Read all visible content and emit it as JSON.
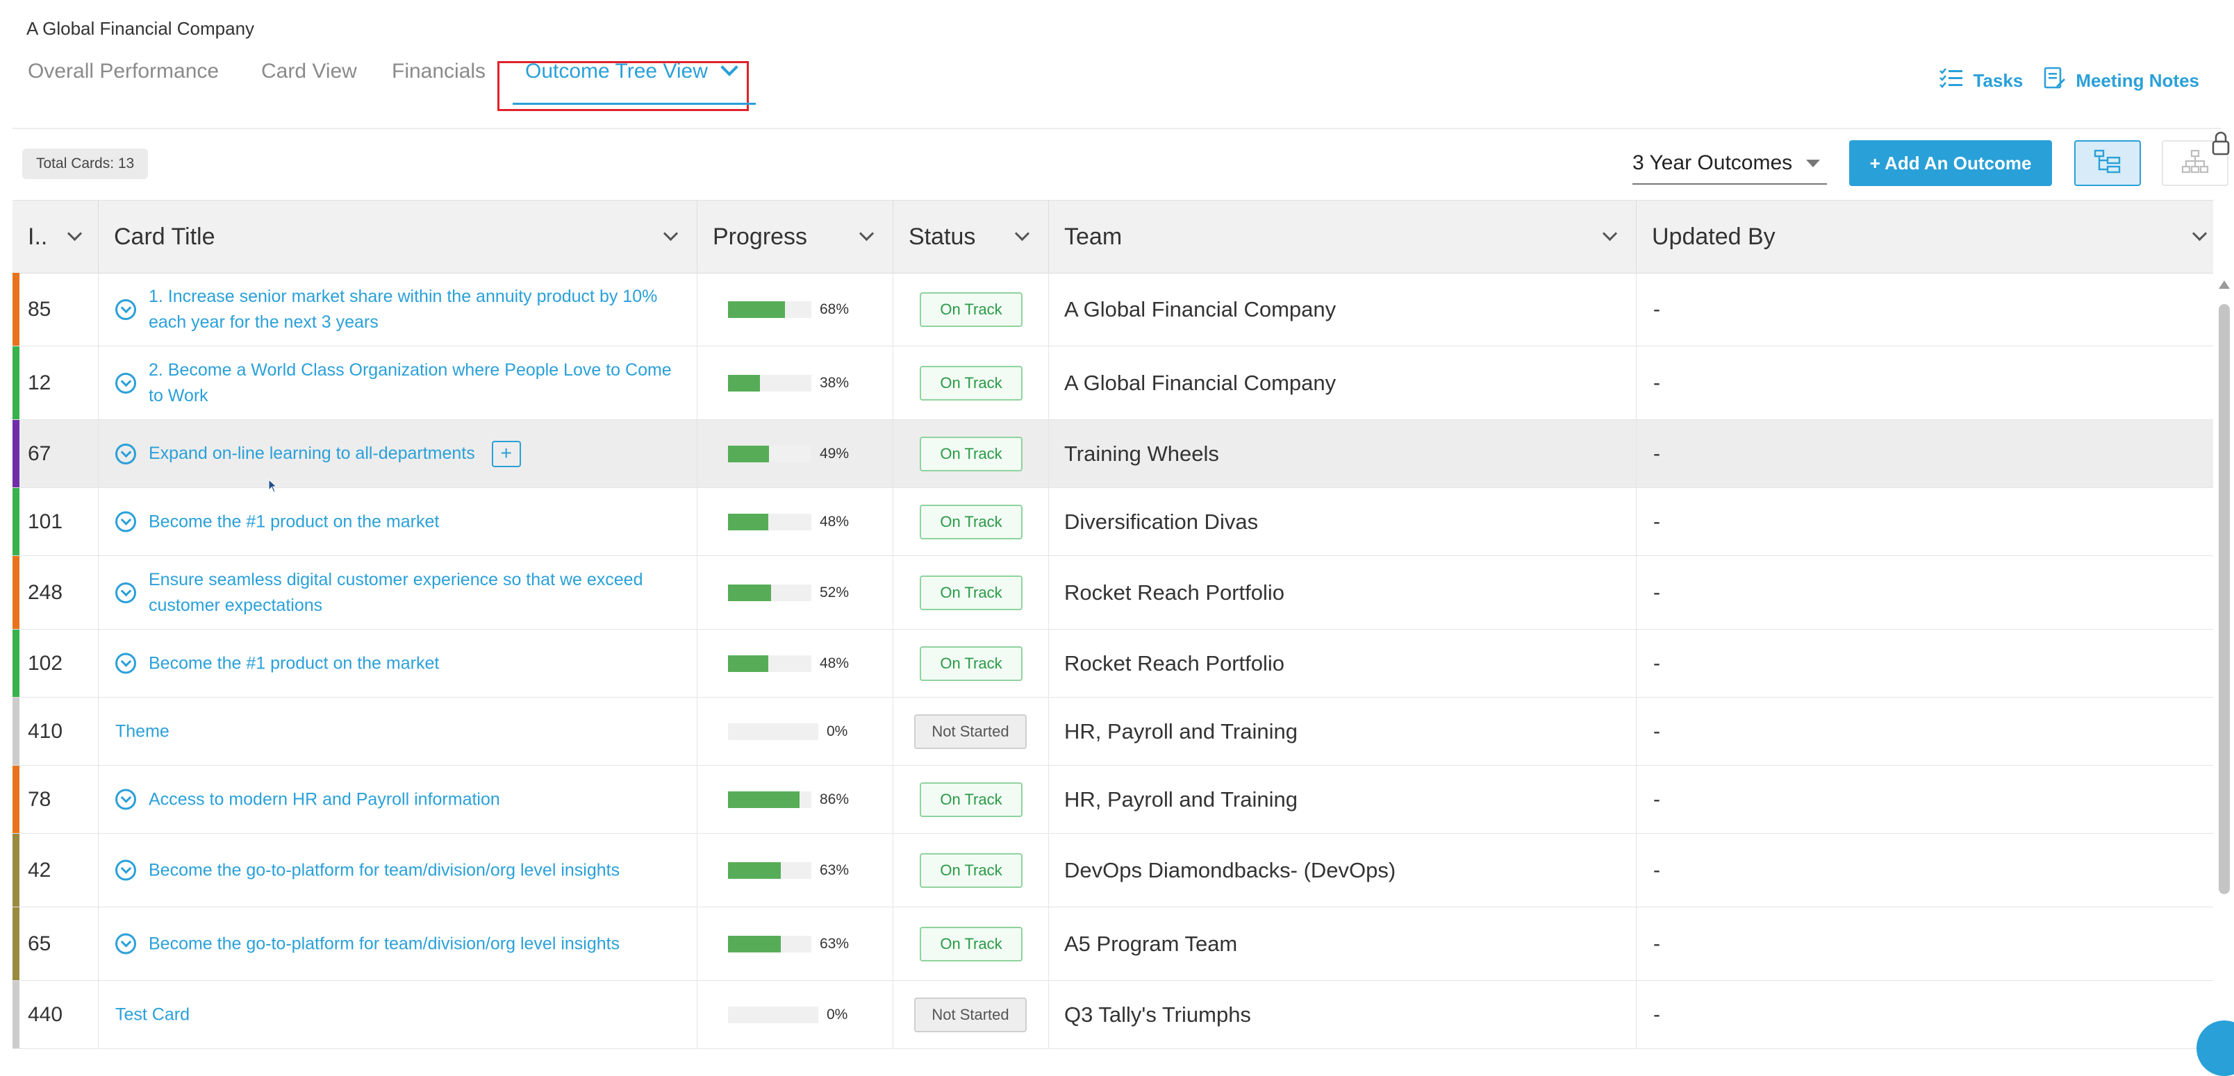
{
  "company": "A Global Financial Company",
  "tabs": [
    {
      "label": "Overall Performance",
      "active": false
    },
    {
      "label": "Card View",
      "active": false
    },
    {
      "label": "Financials",
      "active": false
    },
    {
      "label": "Outcome Tree View",
      "active": true
    }
  ],
  "top_actions": {
    "tasks": "Tasks",
    "meeting_notes": "Meeting Notes"
  },
  "toolbar": {
    "total_cards": "Total Cards: 13",
    "outcome_select": "3 Year Outcomes",
    "add_outcome": "+ Add An Outcome"
  },
  "columns": [
    "I..",
    "Card Title",
    "Progress",
    "Status",
    "Team",
    "Updated By"
  ],
  "rows": [
    {
      "id": "85",
      "title": "1. Increase senior market share within the annuity product by 10% each year for the next 3 years",
      "progress": 68,
      "progress_label": "68%",
      "status": "On Track",
      "team": "A Global Financial Company",
      "updated_by": "-",
      "color": "#e8731c",
      "expandable": true
    },
    {
      "id": "12",
      "title": "2. Become a World Class Organization where People Love to Come to Work",
      "progress": 38,
      "progress_label": "38%",
      "status": "On Track",
      "team": "A Global Financial Company",
      "updated_by": "-",
      "color": "#37b24d",
      "expandable": true
    },
    {
      "id": "67",
      "title": "Expand on-line learning to all-departments",
      "progress": 49,
      "progress_label": "49%",
      "status": "On Track",
      "team": "Training Wheels",
      "updated_by": "-",
      "color": "#6f2da8",
      "expandable": true,
      "plus": "+"
    },
    {
      "id": "101",
      "title": "Become the #1 product on the market",
      "progress": 48,
      "progress_label": "48%",
      "status": "On Track",
      "team": "Diversification Divas",
      "updated_by": "-",
      "color": "#37b24d",
      "expandable": true
    },
    {
      "id": "248",
      "title": "Ensure seamless digital customer experience so that we exceed customer expectations",
      "progress": 52,
      "progress_label": "52%",
      "status": "On Track",
      "team": "Rocket Reach Portfolio",
      "updated_by": "-",
      "color": "#e8731c",
      "expandable": true
    },
    {
      "id": "102",
      "title": "Become the #1 product on the market",
      "progress": 48,
      "progress_label": "48%",
      "status": "On Track",
      "team": "Rocket Reach Portfolio",
      "updated_by": "-",
      "color": "#37b24d",
      "expandable": true
    },
    {
      "id": "410",
      "title": "Theme",
      "progress": 0,
      "progress_label": "0%",
      "status": "Not Started",
      "team": "HR, Payroll and Training",
      "updated_by": "-",
      "color": "#cccccc",
      "expandable": false
    },
    {
      "id": "78",
      "title": "Access to modern HR and Payroll information",
      "progress": 86,
      "progress_label": "86%",
      "status": "On Track",
      "team": "HR, Payroll and Training",
      "updated_by": "-",
      "color": "#e8731c",
      "expandable": true
    },
    {
      "id": "42",
      "title": "Become the go-to-platform for team/division/org level insights",
      "progress": 63,
      "progress_label": "63%",
      "status": "On Track",
      "team": "DevOps Diamondbacks- (DevOps)",
      "updated_by": "-",
      "color": "#9a8a40",
      "expandable": true
    },
    {
      "id": "65",
      "title": "Become the go-to-platform for team/division/org level insights",
      "progress": 63,
      "progress_label": "63%",
      "status": "On Track",
      "team": "A5 Program Team",
      "updated_by": "-",
      "color": "#9a8a40",
      "expandable": true
    },
    {
      "id": "440",
      "title": "Test Card",
      "progress": 0,
      "progress_label": "0%",
      "status": "Not Started",
      "team": "Q3 Tally's Triumphs",
      "updated_by": "-",
      "color": "#cccccc",
      "expandable": false
    }
  ],
  "colors": {
    "accent": "#2aa0d8",
    "on_track": "#2a9a46",
    "progress_fill": "#57ad57",
    "highlight_border": "#e0222a"
  }
}
